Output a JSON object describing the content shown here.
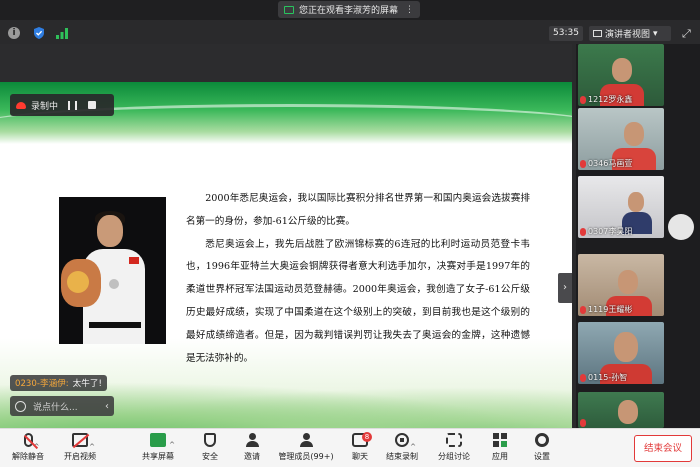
{
  "share_banner": {
    "text": "您正在观看李淑芳的屏幕",
    "more": "⋮"
  },
  "info_bar": {
    "timer": "53:35",
    "view_label": "演讲者视图",
    "view_caret": "▾"
  },
  "recording": {
    "label": "录制中"
  },
  "slide": {
    "paragraphs": [
      "2000年悉尼奥运会，我以国际比赛积分排名世界第一和国内奥运会选拔赛排名第一的身份，参加-61公斤级的比赛。",
      "悉尼奥运会上，我先后战胜了欧洲锦标赛的6连冠的比利时运动员范登卡韦也，1996年亚特兰大奥运会铜牌获得者意大利选手加尔，决赛对手是1997年的柔道世界杯冠军法国运动员范登赫德。2000年奥运会，我创造了女子-61公斤级历史最好成绩，实现了中国柔道在这个级别上的突破，到目前我也是这个级别的最好成绩缔造者。但是，因为裁判错误判罚让我失去了奥运会的金牌，这种遗憾是无法弥补的。"
    ]
  },
  "side_toggle": "›",
  "chat": {
    "last_sender": "0230-李涵伊:",
    "last_message": "太牛了!",
    "input_placeholder": "说点什么...",
    "collapse": "‹"
  },
  "participants": [
    {
      "name": "1212罗永鑫"
    },
    {
      "name": "0346马画萱"
    },
    {
      "name": "0307李昊阳"
    },
    {
      "name": "1119王耀彬"
    },
    {
      "name": "0115-孙智"
    },
    {
      "name": ""
    }
  ],
  "toolbar": {
    "items": [
      {
        "label": "解除静音",
        "icon": "mic-muted-icon"
      },
      {
        "label": "开启视频",
        "icon": "camera-off-icon"
      },
      {
        "label": "共享屏幕",
        "icon": "share-screen-icon"
      },
      {
        "label": "安全",
        "icon": "shield-icon"
      },
      {
        "label": "邀请",
        "icon": "invite-icon"
      },
      {
        "label": "管理成员(99+)",
        "icon": "members-icon"
      },
      {
        "label": "聊天",
        "icon": "chat-icon",
        "badge": "8"
      },
      {
        "label": "结束录制",
        "icon": "record-icon"
      },
      {
        "label": "分组讨论",
        "icon": "breakout-icon"
      },
      {
        "label": "应用",
        "icon": "apps-icon"
      },
      {
        "label": "设置",
        "icon": "gear-icon"
      }
    ],
    "end_meeting": "结束会议"
  },
  "colors": {
    "accent_green": "#2a9d4a",
    "danger_red": "#e23a3a",
    "chat_sender": "#f5a83a"
  }
}
